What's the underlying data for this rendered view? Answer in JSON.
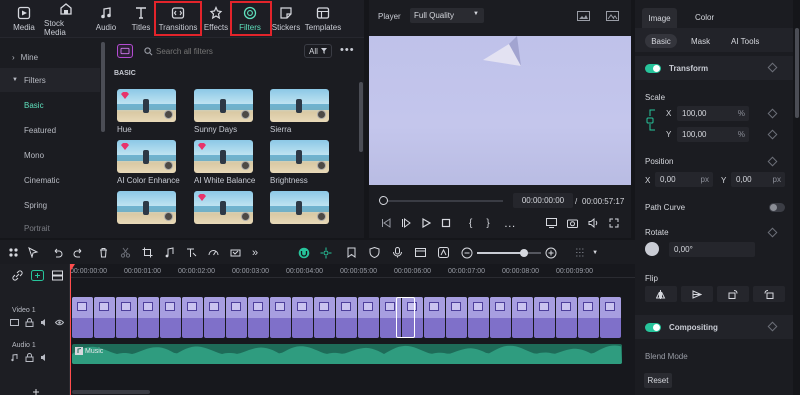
{
  "media_tabs": [
    {
      "label": "Media",
      "icon": "media-icon"
    },
    {
      "label": "Stock Media",
      "icon": "stock-media-icon"
    },
    {
      "label": "Audio",
      "icon": "audio-icon"
    },
    {
      "label": "Titles",
      "icon": "titles-icon"
    },
    {
      "label": "Transitions",
      "icon": "transitions-icon"
    },
    {
      "label": "Effects",
      "icon": "effects-icon"
    },
    {
      "label": "Filters",
      "icon": "filters-icon"
    },
    {
      "label": "Stickers",
      "icon": "stickers-icon"
    },
    {
      "label": "Templates",
      "icon": "templates-icon"
    }
  ],
  "left_nav": {
    "mine": "Mine",
    "filters": "Filters",
    "items": [
      "Basic",
      "Featured",
      "Mono",
      "Cinematic",
      "Spring",
      "Portrait"
    ],
    "active": "Basic"
  },
  "filter_panel": {
    "search_placeholder": "Search all filters",
    "scope": "All",
    "section": "BASIC",
    "items": [
      "Hue",
      "Sunny Days",
      "Sierra",
      "AI Color Enhance",
      "AI White Balance",
      "Brightness"
    ]
  },
  "player": {
    "label": "Player",
    "quality": "Full Quality",
    "current_time": "00:00:00:00",
    "separator": "/",
    "total_time": "00:00:57:17"
  },
  "inspector": {
    "tabs": [
      "Image",
      "Color"
    ],
    "subtabs": [
      "Basic",
      "Mask",
      "AI Tools"
    ],
    "transform": "Transform",
    "scale": "Scale",
    "scale_x": "100,00",
    "scale_y": "100,00",
    "percent": "%",
    "position": "Position",
    "pos_x": "0,00",
    "pos_y": "0,00",
    "px": "px",
    "x": "X",
    "y": "Y",
    "path_curve": "Path Curve",
    "rotate": "Rotate",
    "rotate_value": "0,00°",
    "flip": "Flip",
    "compositing": "Compositing",
    "blend_mode": "Blend Mode",
    "reset": "Reset"
  },
  "timeline": {
    "ruler": [
      "00:00:00:00",
      "00:00:01:00",
      "00:00:02:00",
      "00:00:03:00",
      "00:00:04:00",
      "00:00:05:00",
      "00:00:06:00",
      "00:00:07:00",
      "00:00:08:00",
      "00:00:09:00"
    ],
    "video_track": "Video 1",
    "audio_track": "Audio 1",
    "audio_clip": "Music"
  },
  "colors": {
    "accent": "#27c49b",
    "highlight": "#e3242b",
    "clip": "#7f70c9",
    "audio": "#2f9c7f"
  }
}
